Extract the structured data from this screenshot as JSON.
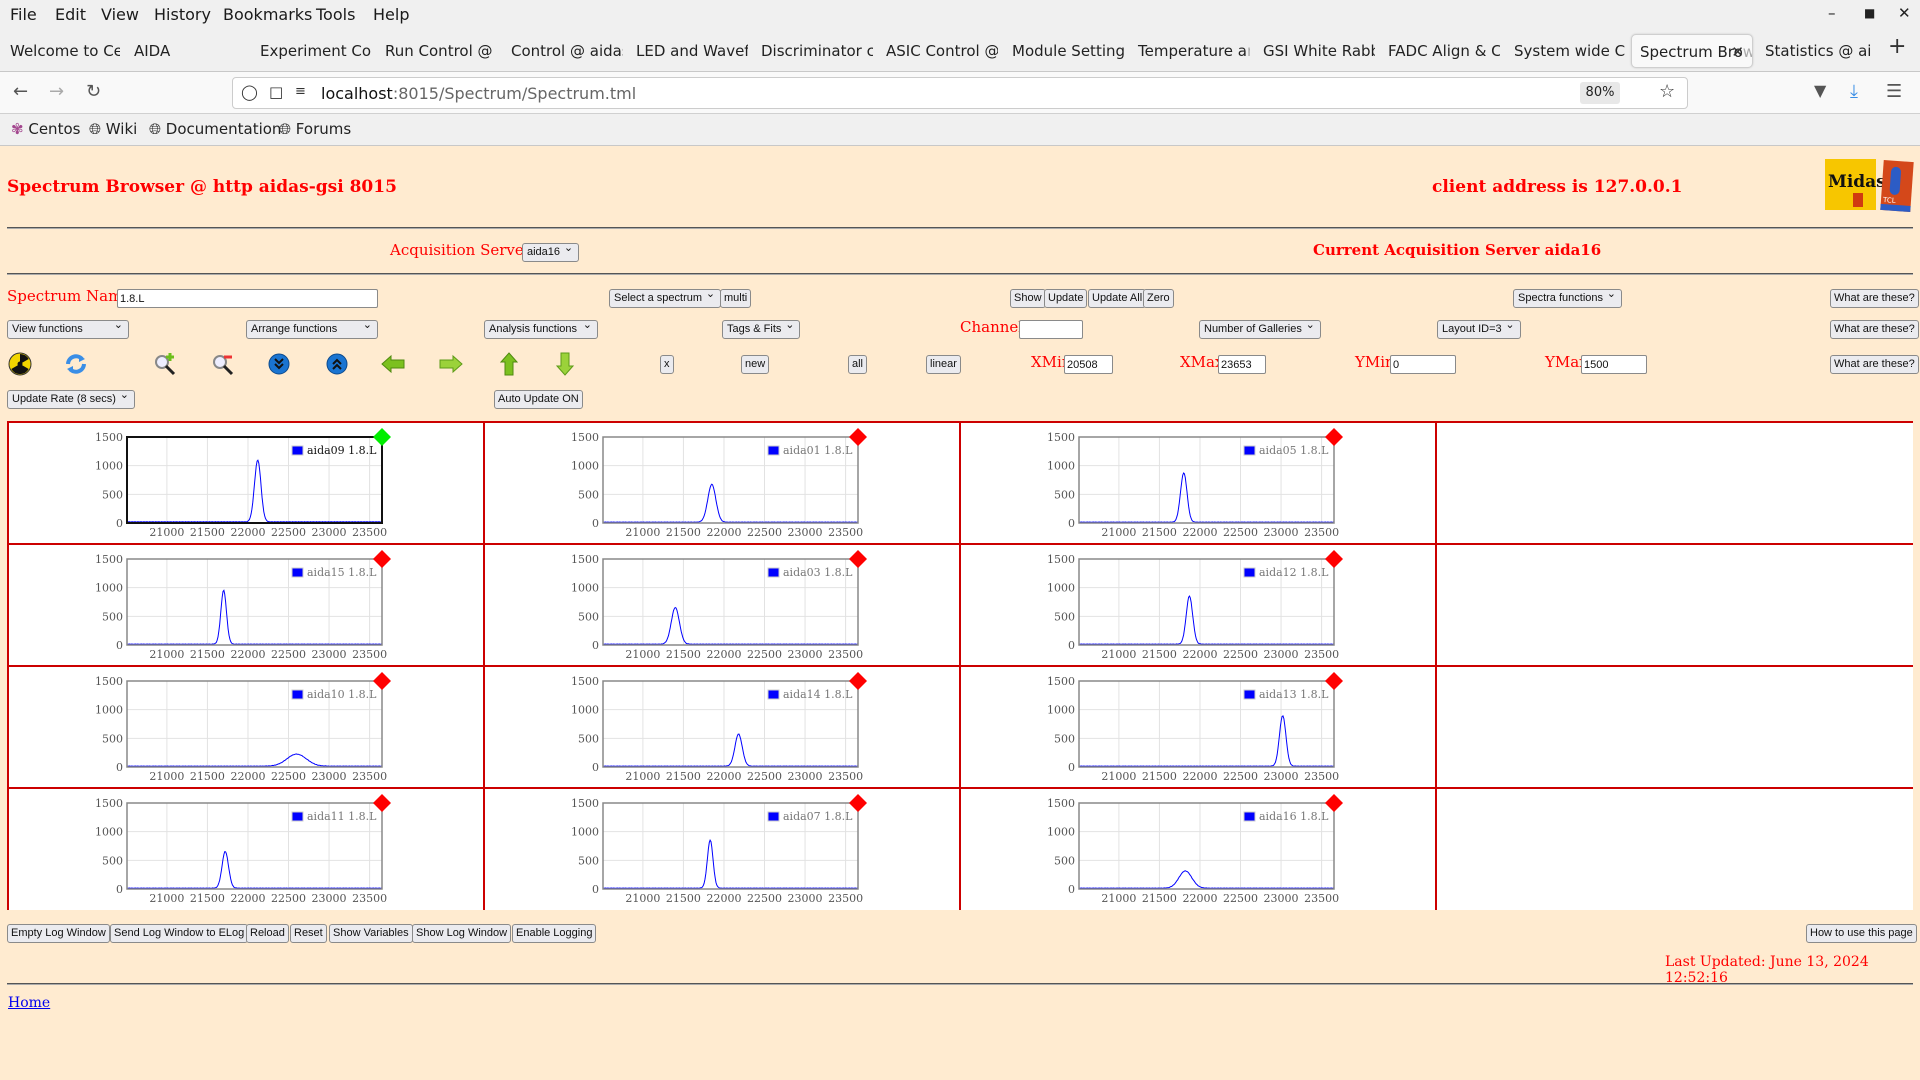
{
  "browser": {
    "menu": [
      "File",
      "Edit",
      "View",
      "History",
      "Bookmarks",
      "Tools",
      "Help"
    ],
    "tabs": [
      {
        "label": "Welcome to Ce",
        "fade": "r"
      },
      {
        "label": "AIDA",
        "fade": ""
      },
      {
        "label": "Experiment Con",
        "fade": "t"
      },
      {
        "label": "Run Control @ ",
        "fade": "a"
      },
      {
        "label": "Control @ aidas",
        "fade": "-"
      },
      {
        "label": "LED and Wavef",
        "fade": "o"
      },
      {
        "label": "Discriminator c",
        "fade": "o"
      },
      {
        "label": "ASIC Control @",
        "fade": ""
      },
      {
        "label": "Module Setting",
        "fade": "s"
      },
      {
        "label": "Temperature a",
        "fade": "n"
      },
      {
        "label": "GSI White Rabb",
        "fade": "i"
      },
      {
        "label": "FADC Align & C",
        "fade": "o"
      },
      {
        "label": "System wide C",
        "fade": "h"
      },
      {
        "label": "Spectrum Bro",
        "fade": "w",
        "active": true
      },
      {
        "label": "Statistics @ ai",
        "fade": "da"
      }
    ],
    "url_host": "localhost",
    "url_rest": ":8015/Spectrum/Spectrum.tml",
    "zoom": "80%",
    "bookmarks": [
      "Centos",
      "Wiki",
      "Documentation",
      "Forums"
    ]
  },
  "page": {
    "title": "Spectrum Browser @ http aidas-gsi 8015",
    "client_address": "client address is 127.0.0.1",
    "acq_servers_label": "Acquisition Servers",
    "acq_server_selected": "aida16",
    "current_acq_server": "Current Acquisition Server aida16",
    "spectrum_name_label": "Spectrum Name:",
    "spectrum_name_value": "1.8.L",
    "select_spectrum": "Select a spectrum",
    "multi": "multi",
    "show": "Show",
    "update": "Update",
    "update_all": "Update All",
    "zero": "Zero",
    "spectra_functions": "Spectra functions",
    "what_are_these": "What are these?",
    "view_functions": "View functions",
    "arrange_functions": "Arrange functions",
    "analysis_functions": "Analysis functions",
    "tags_fits": "Tags & Fits",
    "channel_label": "Channel:",
    "channel_value": "",
    "number_of_galleries": "Number of Galleries",
    "layout_id": "Layout ID=3",
    "x_btn": "x",
    "new_btn": "new",
    "all_btn": "all",
    "linear_btn": "linear",
    "xmin_label": "XMin",
    "xmin_value": "20508",
    "xmax_label": "XMax",
    "xmax_value": "23653",
    "ymin_label": "YMin",
    "ymin_value": "0",
    "ymax_label": "YMax",
    "ymax_value": "1500",
    "update_rate": "Update Rate (8 secs)",
    "auto_update": "Auto Update ON",
    "bottom_buttons": [
      "Empty Log Window",
      "Send Log Window to ELog",
      "Reload",
      "Reset",
      "Show Variables",
      "Show Log Window",
      "Enable Logging"
    ],
    "how_to_use": "How to use this page",
    "last_updated": "Last Updated: June 13, 2024 12:52:16",
    "home_link": "Home",
    "colors": {
      "accent_red": "#ff0000",
      "page_bg": "#ffebd0",
      "series": "#0000ff",
      "status_ok": "#00ee00",
      "status_bad": "#ff0000"
    }
  },
  "chart_data": [
    {
      "type": "line",
      "title": "",
      "legend": "aida09 1.8.L",
      "status": "ok",
      "peak_x": 22120,
      "peak_y": 1080,
      "width": 40,
      "baseline": 20,
      "xlim": [
        20508,
        23653
      ],
      "ylim": [
        0,
        1500
      ],
      "xticks": [
        21000,
        21500,
        22000,
        22500,
        23000,
        23500
      ],
      "yticks": [
        0,
        500,
        1000,
        1500
      ],
      "selected": true
    },
    {
      "type": "line",
      "title": "",
      "legend": "aida01 1.8.L",
      "status": "bad",
      "peak_x": 21850,
      "peak_y": 660,
      "width": 50,
      "baseline": 15,
      "xlim": [
        20508,
        23653
      ],
      "ylim": [
        0,
        1500
      ],
      "xticks": [
        21000,
        21500,
        22000,
        22500,
        23000,
        23500
      ],
      "yticks": [
        0,
        500,
        1000,
        1500
      ]
    },
    {
      "type": "line",
      "title": "",
      "legend": "aida05 1.8.L",
      "status": "bad",
      "peak_x": 21800,
      "peak_y": 860,
      "width": 40,
      "baseline": 15,
      "xlim": [
        20508,
        23653
      ],
      "ylim": [
        0,
        1500
      ],
      "xticks": [
        21000,
        21500,
        22000,
        22500,
        23000,
        23500
      ],
      "yticks": [
        0,
        500,
        1000,
        1500
      ]
    },
    {
      "type": "line",
      "title": "",
      "legend": "aida15 1.8.L",
      "status": "bad",
      "peak_x": 21700,
      "peak_y": 940,
      "width": 35,
      "baseline": 15,
      "xlim": [
        20508,
        23653
      ],
      "ylim": [
        0,
        1500
      ],
      "xticks": [
        21000,
        21500,
        22000,
        22500,
        23000,
        23500
      ],
      "yticks": [
        0,
        500,
        1000,
        1500
      ]
    },
    {
      "type": "line",
      "title": "",
      "legend": "aida03 1.8.L",
      "status": "bad",
      "peak_x": 21400,
      "peak_y": 640,
      "width": 50,
      "baseline": 15,
      "xlim": [
        20508,
        23653
      ],
      "ylim": [
        0,
        1500
      ],
      "xticks": [
        21000,
        21500,
        22000,
        22500,
        23000,
        23500
      ],
      "yticks": [
        0,
        500,
        1000,
        1500
      ]
    },
    {
      "type": "line",
      "title": "",
      "legend": "aida12 1.8.L",
      "status": "bad",
      "peak_x": 21870,
      "peak_y": 840,
      "width": 40,
      "baseline": 15,
      "xlim": [
        20508,
        23653
      ],
      "ylim": [
        0,
        1500
      ],
      "xticks": [
        21000,
        21500,
        22000,
        22500,
        23000,
        23500
      ],
      "yticks": [
        0,
        500,
        1000,
        1500
      ]
    },
    {
      "type": "line",
      "title": "",
      "legend": "aida10 1.8.L",
      "status": "bad",
      "peak_x": 22600,
      "peak_y": 210,
      "width": 120,
      "baseline": 15,
      "xlim": [
        20508,
        23653
      ],
      "ylim": [
        0,
        1500
      ],
      "xticks": [
        21000,
        21500,
        22000,
        22500,
        23000,
        23500
      ],
      "yticks": [
        0,
        500,
        1000,
        1500
      ]
    },
    {
      "type": "line",
      "title": "",
      "legend": "aida14 1.8.L",
      "status": "bad",
      "peak_x": 22180,
      "peak_y": 560,
      "width": 45,
      "baseline": 15,
      "xlim": [
        20508,
        23653
      ],
      "ylim": [
        0,
        1500
      ],
      "xticks": [
        21000,
        21500,
        22000,
        22500,
        23000,
        23500
      ],
      "yticks": [
        0,
        500,
        1000,
        1500
      ]
    },
    {
      "type": "line",
      "title": "",
      "legend": "aida13 1.8.L",
      "status": "bad",
      "peak_x": 23020,
      "peak_y": 880,
      "width": 40,
      "baseline": 15,
      "xlim": [
        20508,
        23653
      ],
      "ylim": [
        0,
        1500
      ],
      "xticks": [
        21000,
        21500,
        22000,
        22500,
        23000,
        23500
      ],
      "yticks": [
        0,
        500,
        1000,
        1500
      ]
    },
    {
      "type": "line",
      "title": "",
      "legend": "aida11 1.8.L",
      "status": "bad",
      "peak_x": 21720,
      "peak_y": 640,
      "width": 40,
      "baseline": 15,
      "xlim": [
        20508,
        23653
      ],
      "ylim": [
        0,
        1500
      ],
      "xticks": [
        21000,
        21500,
        22000,
        22500,
        23000,
        23500
      ],
      "yticks": [
        0,
        500,
        1000,
        1500
      ]
    },
    {
      "type": "line",
      "title": "",
      "legend": "aida07 1.8.L",
      "status": "bad",
      "peak_x": 21830,
      "peak_y": 840,
      "width": 35,
      "baseline": 15,
      "xlim": [
        20508,
        23653
      ],
      "ylim": [
        0,
        1500
      ],
      "xticks": [
        21000,
        21500,
        22000,
        22500,
        23000,
        23500
      ],
      "yticks": [
        0,
        500,
        1000,
        1500
      ]
    },
    {
      "type": "line",
      "title": "",
      "legend": "aida16 1.8.L",
      "status": "bad",
      "peak_x": 21820,
      "peak_y": 300,
      "width": 80,
      "baseline": 15,
      "xlim": [
        20508,
        23653
      ],
      "ylim": [
        0,
        1500
      ],
      "xticks": [
        21000,
        21500,
        22000,
        22500,
        23000,
        23500
      ],
      "yticks": [
        0,
        500,
        1000,
        1500
      ]
    }
  ]
}
